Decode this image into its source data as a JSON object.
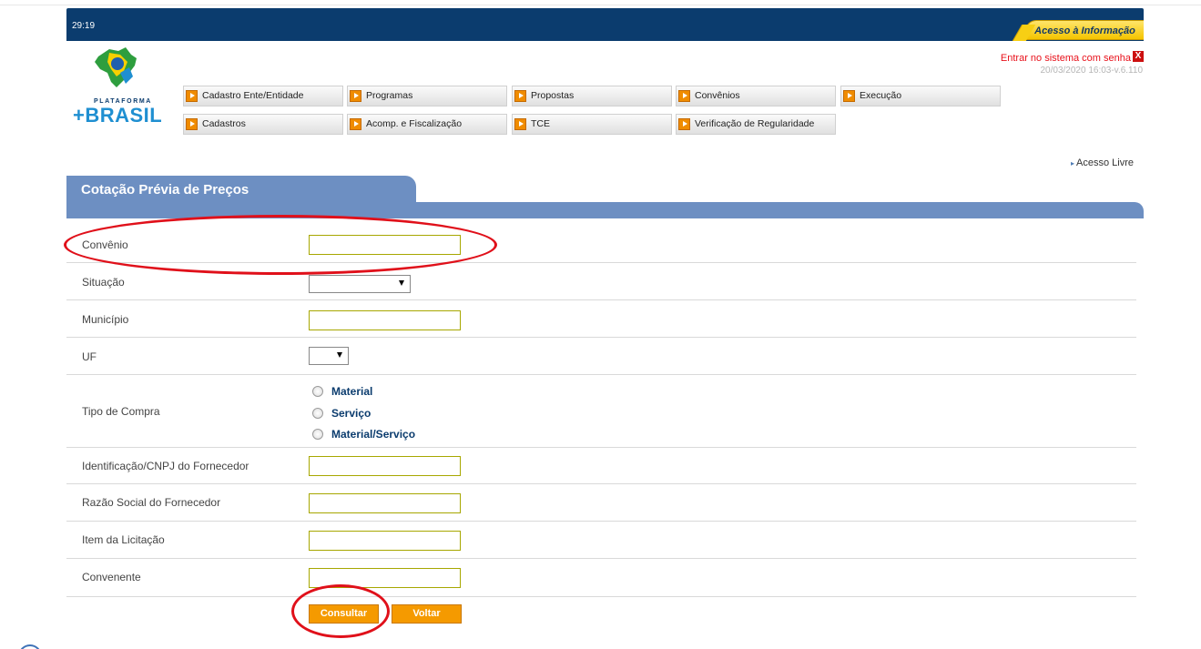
{
  "header": {
    "timer": "29:19",
    "acesso_informacao": "Acesso à Informação",
    "login_link": "Entrar no sistema com senha",
    "close_glyph": "X",
    "version": "20/03/2020 16:03-v.6.110"
  },
  "logo": {
    "small": "PLATAFORMA",
    "big": "+BRASIL"
  },
  "menu": {
    "row1": [
      "Cadastro Ente/Entidade",
      "Programas",
      "Propostas",
      "Convênios",
      "Execução"
    ],
    "row2": [
      "Cadastros",
      "Acomp. e Fiscalização",
      "TCE",
      "Verificação de Regularidade"
    ]
  },
  "acesso_livre": "Acesso Livre",
  "panel": {
    "title": "Cotação Prévia de Preços"
  },
  "form": {
    "convenio": {
      "label": "Convênio",
      "value": ""
    },
    "situacao": {
      "label": "Situação",
      "selected": ""
    },
    "municipio": {
      "label": "Município",
      "value": ""
    },
    "uf": {
      "label": "UF",
      "selected": ""
    },
    "tipo_compra": {
      "label": "Tipo de Compra",
      "options": [
        "Material",
        "Serviço",
        "Material/Serviço"
      ]
    },
    "cnpj": {
      "label": "Identificação/CNPJ do Fornecedor",
      "value": ""
    },
    "razao_social": {
      "label": "Razão Social do Fornecedor",
      "value": ""
    },
    "item_licitacao": {
      "label": "Item da Licitação",
      "value": ""
    },
    "convenente": {
      "label": "Convenente",
      "value": ""
    }
  },
  "buttons": {
    "consultar": "Consultar",
    "voltar": "Voltar"
  },
  "colors": {
    "header": "#0b3c6e",
    "panel": "#6d8fc2",
    "button": "#f59a00",
    "annotation": "#e0101a"
  }
}
